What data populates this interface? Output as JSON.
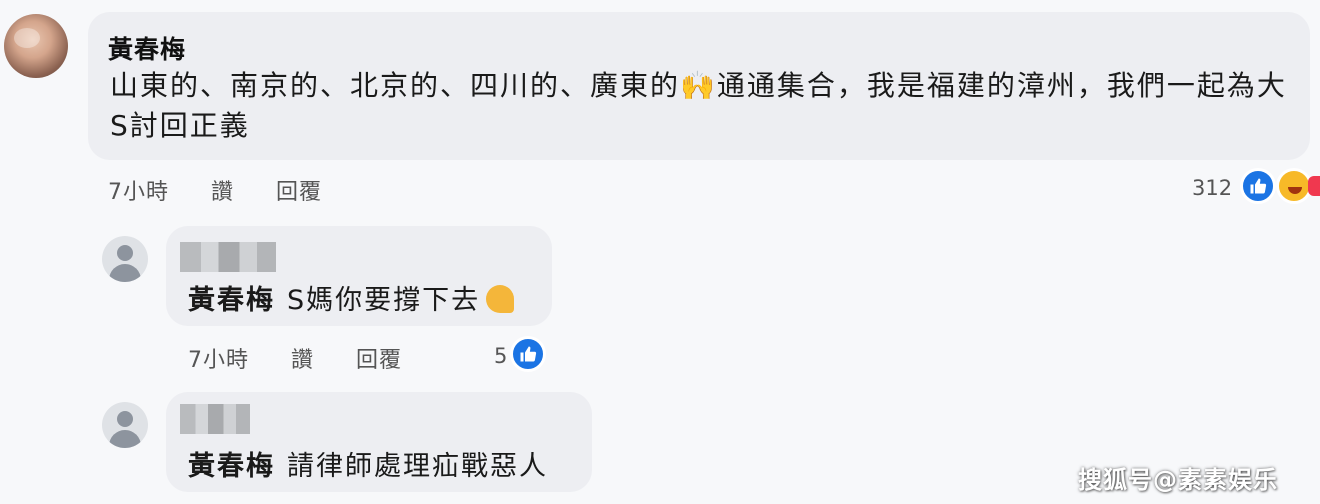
{
  "comment": {
    "author": "黃春梅",
    "text": "山東的、南京的、北京的、四川的、廣東的🙌通通集合，我是福建的漳州，我們一起為大S討回正義",
    "time": "7小時",
    "like_label": "讚",
    "reply_label": "回覆",
    "reaction_count": "312",
    "reaction_icons": [
      "like-icon",
      "haha-icon",
      "heart-icon"
    ],
    "like_color": "#1b74e4"
  },
  "replies": [
    {
      "mention": "黃春梅",
      "text": "S媽你要撐下去",
      "emoji": "muscle-emoji",
      "time": "7小時",
      "like_label": "讚",
      "reply_label": "回覆",
      "reaction_count": "5"
    },
    {
      "mention": "黃春梅",
      "text": "請律師處理疝戰惡人"
    }
  ],
  "watermark": "搜狐号@素素娱乐"
}
